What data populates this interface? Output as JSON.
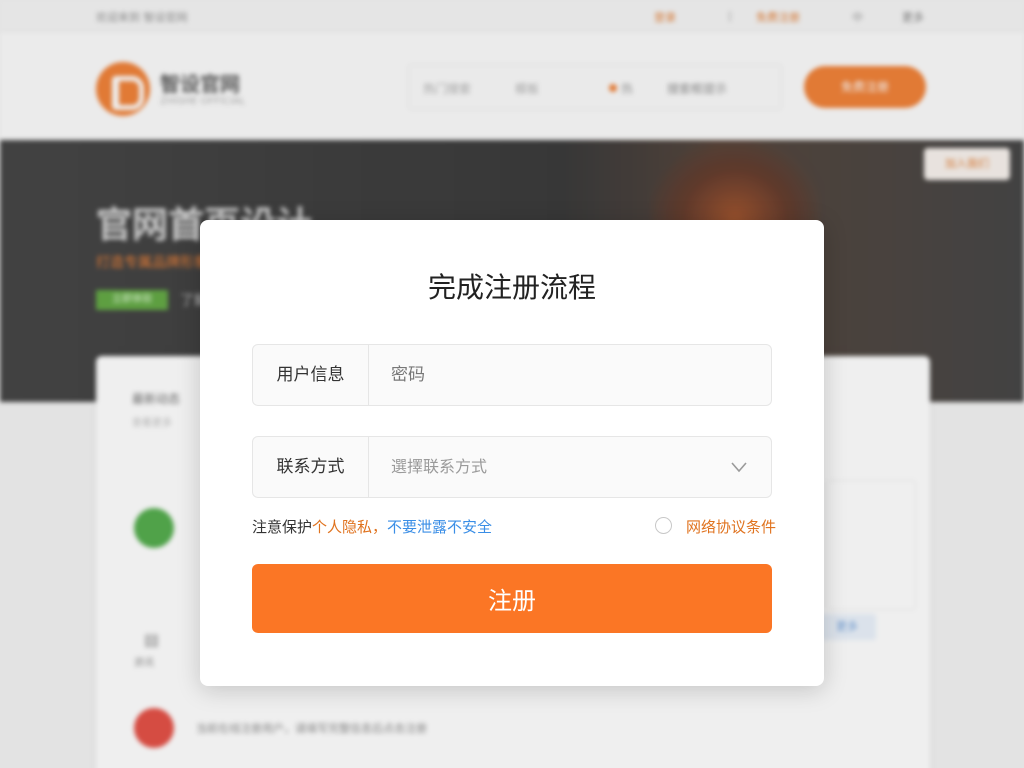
{
  "background": {
    "topbar": {
      "left_text": "欢迎来到 智设官网",
      "right_1": "登录",
      "right_2": "|",
      "right_3": "免费注册",
      "right_4": "中",
      "right_5": "更多"
    },
    "header": {
      "logo_name": "智设官网",
      "logo_sub": "ZHISHE OFFICIAL",
      "search_items": [
        "热门搜索",
        "模板",
        "热",
        "搜索框提示"
      ],
      "cta_button": "免费注册"
    },
    "banner": {
      "title": "官网首页设计",
      "subtitle": "打造专属品牌形象",
      "tag": "立即体验",
      "tag2": "了解",
      "badge": "加入我们"
    },
    "card": {
      "heading": "最新动态",
      "subheading": "查看更多",
      "icon_label": "资讯",
      "chip": "更多",
      "footer_text": "当前在线注册用户，请填写完整信息后点击注册"
    }
  },
  "modal": {
    "title": "完成注册流程",
    "user_info": {
      "label": "用户信息",
      "placeholder": "密码"
    },
    "contact": {
      "label": "联系方式",
      "value": "選擇联系方式"
    },
    "notice": {
      "prefix": "注意保护",
      "orange": "个人隐私，",
      "blue": "不要泄露不安全"
    },
    "agreement_label": "网络协议条件",
    "submit_label": "注册"
  },
  "colors": {
    "accent": "#fb7625",
    "link_blue": "#3a8ee6",
    "notice_orange": "#e0731f"
  },
  "icons": [
    "chevron-down-icon",
    "radio-icon"
  ]
}
